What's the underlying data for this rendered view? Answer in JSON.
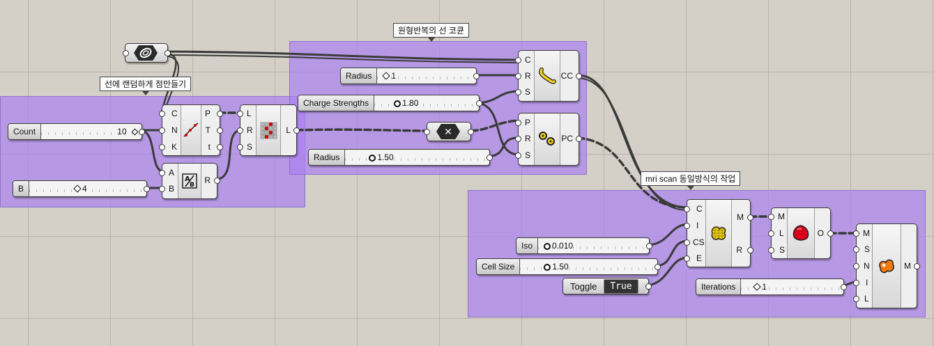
{
  "groups": [
    {
      "label": "선에 랜덤하게 점만들기"
    },
    {
      "label": "원형반복의 선 코큔"
    },
    {
      "label": "mri scan 동일방식의 작업"
    }
  ],
  "components": {
    "random_points": {
      "inputs": [
        "C",
        "N",
        "K"
      ],
      "outputs": [
        "P",
        "T",
        "t"
      ]
    },
    "point_charge": {
      "inputs": [
        "L",
        "R",
        "S"
      ],
      "outputs": [
        "L"
      ]
    },
    "modulus": {
      "inputs": [
        "A",
        "B"
      ],
      "outputs": [
        "R"
      ]
    },
    "curve_charge": {
      "inputs": [
        "C",
        "R",
        "S"
      ],
      "outputs": [
        "CC"
      ]
    },
    "pt_charge2": {
      "inputs": [
        "P",
        "R",
        "S"
      ],
      "outputs": [
        "PC"
      ]
    },
    "mri_scan": {
      "inputs": [
        "C",
        "I",
        "CS",
        "E"
      ],
      "outputs": [
        "M",
        "R"
      ]
    },
    "mesh_lod": {
      "inputs": [
        "M",
        "L",
        "S"
      ],
      "outputs": [
        "O"
      ]
    },
    "smooth": {
      "inputs": [
        "M",
        "S",
        "N",
        "I",
        "L"
      ],
      "outputs": [
        "M"
      ]
    }
  },
  "sliders": {
    "count": {
      "label": "Count",
      "value": "10"
    },
    "b": {
      "label": "B",
      "value": "4"
    },
    "radius1": {
      "label": "Radius",
      "value": "1"
    },
    "charge": {
      "label": "Charge Strengths",
      "value": "1.80"
    },
    "radius2": {
      "label": "Radius",
      "value": "1.50"
    },
    "iso": {
      "label": "Iso",
      "value": "0.010"
    },
    "cellsize": {
      "label": "Cell Size",
      "value": "1.50"
    },
    "iterations": {
      "label": "Iterations",
      "value": "1"
    }
  },
  "toggle": {
    "label": "Toggle",
    "value": "True"
  },
  "colors": {
    "group": "#aa82f0",
    "wire": "#3a3a3a",
    "icon_yellow": "#f2d21a",
    "icon_red": "#d9001b",
    "icon_orange": "#f07a10"
  }
}
